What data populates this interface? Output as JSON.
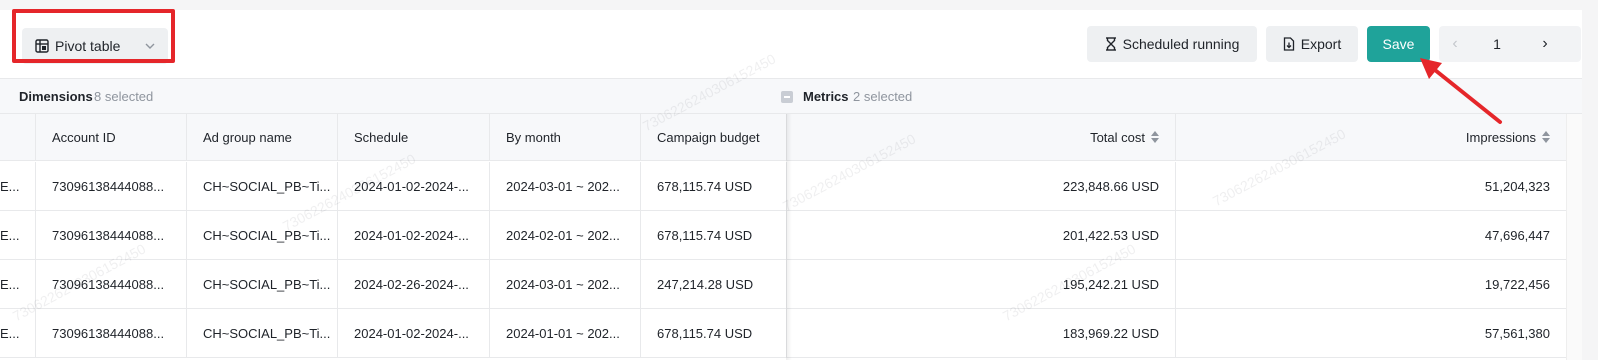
{
  "toolbar": {
    "view_select_label": "Pivot table",
    "scheduled_label": "Scheduled running",
    "export_label": "Export",
    "save_label": "Save",
    "page_number": "1"
  },
  "sections": {
    "dimensions_title": "Dimensions",
    "dimensions_count": "8 selected",
    "metrics_title": "Metrics",
    "metrics_count": "2 selected"
  },
  "table": {
    "headers": [
      "Account ID",
      "Ad group name",
      "Schedule",
      "By month",
      "Campaign budget",
      "Total cost",
      "Impressions"
    ],
    "rows": [
      {
        "lead": "E...",
        "account_id": "73096138444088...",
        "ad_group": "CH~SOCIAL_PB~Ti...",
        "schedule": "2024-01-02-2024-...",
        "by_month": "2024-03-01 ~ 202...",
        "budget": "678,115.74 USD",
        "total_cost": "223,848.66 USD",
        "impressions": "51,204,323"
      },
      {
        "lead": "E...",
        "account_id": "73096138444088...",
        "ad_group": "CH~SOCIAL_PB~Ti...",
        "schedule": "2024-01-02-2024-...",
        "by_month": "2024-02-01 ~ 202...",
        "budget": "678,115.74 USD",
        "total_cost": "201,422.53 USD",
        "impressions": "47,696,447"
      },
      {
        "lead": "E...",
        "account_id": "73096138444088...",
        "ad_group": "CH~SOCIAL_PB~Ti...",
        "schedule": "2024-02-26-2024-...",
        "by_month": "2024-03-01 ~ 202...",
        "budget": "247,214.28 USD",
        "total_cost": "195,242.21 USD",
        "impressions": "19,722,456"
      },
      {
        "lead": "E...",
        "account_id": "73096138444088...",
        "ad_group": "CH~SOCIAL_PB~Ti...",
        "schedule": "2024-01-02-2024-...",
        "by_month": "2024-01-01 ~ 202...",
        "budget": "678,115.74 USD",
        "total_cost": "183,969.22 USD",
        "impressions": "57,561,380"
      }
    ]
  },
  "watermark_text": "7306226240306152450",
  "colors": {
    "save_button": "#1fa39a",
    "annotation_red": "#e5262a",
    "page_background": "#f5f5f6"
  }
}
